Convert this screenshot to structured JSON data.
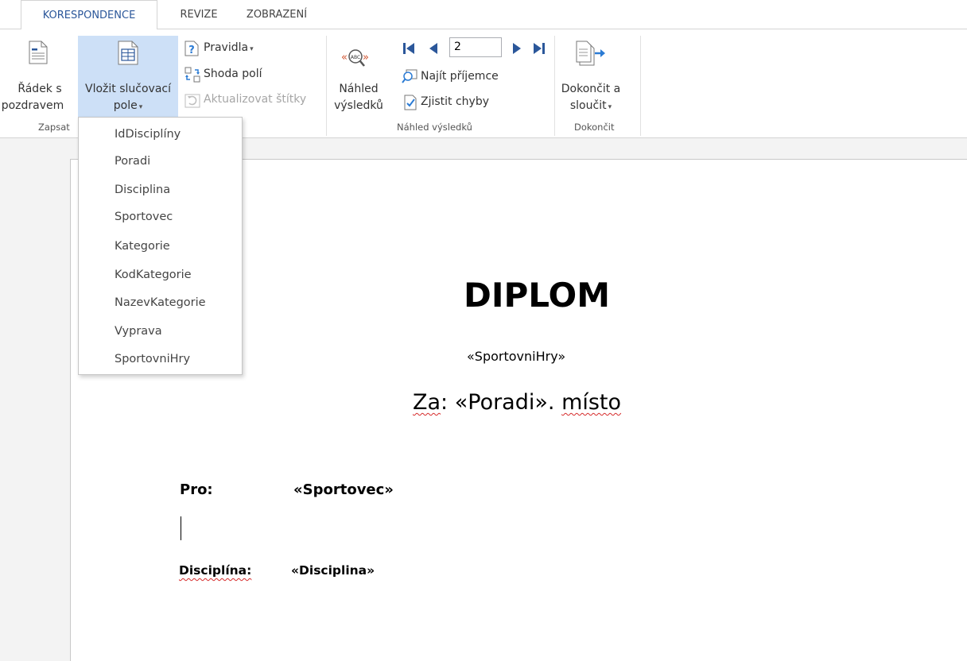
{
  "tabs": [
    {
      "label": "KORESPONDENCE",
      "active": true
    },
    {
      "label": "REVIZE",
      "active": false
    },
    {
      "label": "ZOBRAZENÍ",
      "active": false
    }
  ],
  "ribbon": {
    "zapsat": {
      "radek_line1": "Řádek s",
      "radek_line2": "pozdravem",
      "vlozit_line1": "Vložit slučovací",
      "vlozit_line2": "pole",
      "pravidla": "Pravidla",
      "shoda": "Shoda polí",
      "aktualizovat": "Aktualizovat štítky",
      "group_label": "Zapsat"
    },
    "nahled": {
      "nahled_line1": "Náhled",
      "nahled_line2": "výsledků",
      "record_value": "2",
      "najit": "Najít příjemce",
      "zjistit": "Zjistit chyby",
      "group_label": "Náhled výsledků"
    },
    "dokoncit": {
      "line1": "Dokončit a",
      "line2": "sloučit",
      "group_label": "Dokončit"
    }
  },
  "merge_fields_menu": {
    "items": [
      "IdDisciplíny",
      "Poradi",
      "Disciplina",
      "Sportovec",
      "Kategorie",
      "KodKategorie",
      "NazevKategorie",
      "Vyprava",
      "SportovniHry"
    ]
  },
  "document": {
    "title": "DIPLOM",
    "games_field": "«SportovniHry»",
    "za_word": "Za",
    "za_colon": ": «Poradi». ",
    "misto_word": "místo",
    "pro_label": "Pro:",
    "pro_value": "«Sportovec»",
    "disciplina_label": "Disciplína:",
    "disciplina_value": "«Disciplina»"
  }
}
